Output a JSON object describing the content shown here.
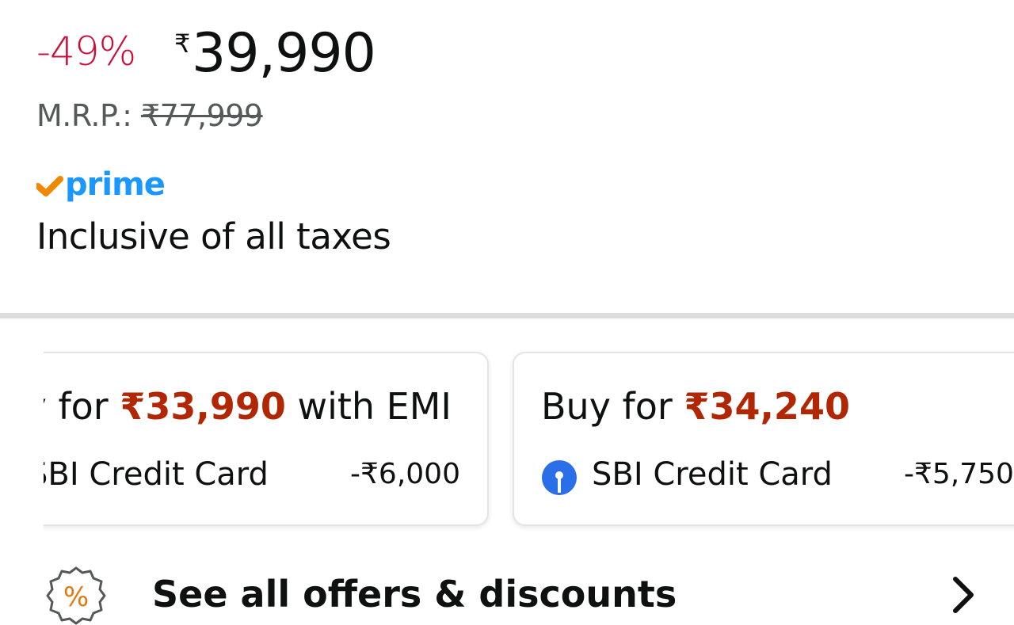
{
  "price": {
    "discount": "-49%",
    "currency": "₹",
    "amount": "39,990",
    "mrp_label": "M.R.P.: ",
    "mrp_value": "₹77,999",
    "discount_color": "#cc0c39"
  },
  "prime": {
    "logo_text": "prime"
  },
  "taxes_note": "Inclusive of all taxes",
  "offers": [
    {
      "title_prefix": "Buy for ",
      "title_amount": "₹33,990",
      "title_suffix": " with EMI",
      "bank": "SBI Credit Card",
      "bank_discount": "-₹6,000",
      "bank_icon": "sbi-logo-icon"
    },
    {
      "title_prefix": "Buy for ",
      "title_amount": "₹34,240",
      "title_suffix": "",
      "bank": "SBI Credit Card",
      "bank_discount": "-₹5,750",
      "bank_icon": "sbi-logo-icon"
    }
  ],
  "see_all": {
    "label": "See all offers & discounts",
    "icon": "percent-badge-icon",
    "chevron_icon": "chevron-right-icon"
  },
  "colors": {
    "accent_red": "#b12704",
    "prime_blue": "#1a98ff",
    "prime_orange": "#f08804",
    "sbi_blue": "#2a6ee8"
  }
}
